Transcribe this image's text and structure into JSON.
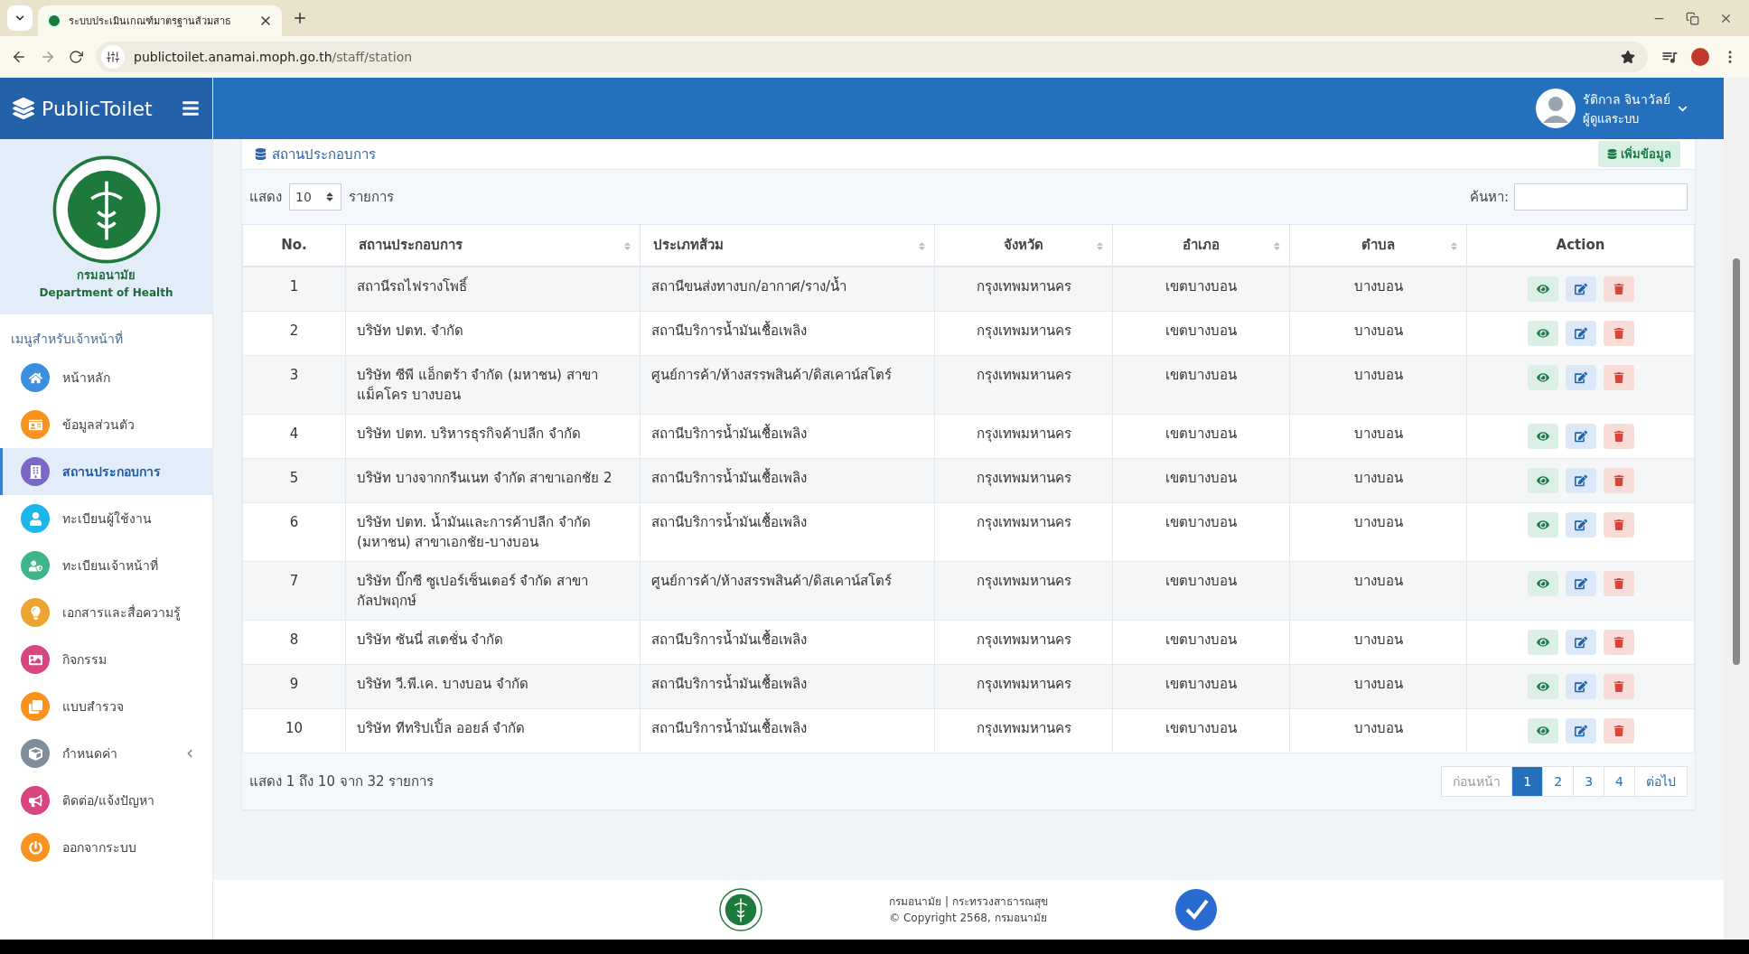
{
  "browser": {
    "tab_title": "ระบบประเมินเกณฑ์มาตรฐานส้วมสาธ",
    "url_host": "publictoilet.anamai.moph.go.th",
    "url_path": "/staff/station"
  },
  "header": {
    "brand": "PublicToilet",
    "user_name": "รัติกาล จินาวัลย์",
    "user_role": "ผู้ดูแลระบบ"
  },
  "sidebar": {
    "org_th": "กรมอนามัย",
    "org_en": "Department of Health",
    "menu_heading": "เมนูสำหรับเจ้าหน้าที่",
    "items": [
      {
        "label": "หน้าหลัก",
        "kind": "home",
        "color": "#3b8ee0",
        "selected": false,
        "submenu": false
      },
      {
        "label": "ข้อมูลส่วนตัว",
        "kind": "card",
        "color": "#f7931e",
        "selected": false,
        "submenu": false
      },
      {
        "label": "สถานประกอบการ",
        "kind": "building",
        "color": "#7b68c4",
        "selected": true,
        "submenu": false
      },
      {
        "label": "ทะเบียนผู้ใช้งาน",
        "kind": "user",
        "color": "#1cb6e8",
        "selected": false,
        "submenu": false
      },
      {
        "label": "ทะเบียนเจ้าหน้าที่",
        "kind": "staff",
        "color": "#3fb58a",
        "selected": false,
        "submenu": false
      },
      {
        "label": "เอกสารและสื่อความรู้",
        "kind": "bulb",
        "color": "#eda531",
        "selected": false,
        "submenu": false
      },
      {
        "label": "กิจกรรม",
        "kind": "image",
        "color": "#d9457f",
        "selected": false,
        "submenu": false
      },
      {
        "label": "แบบสำรวจ",
        "kind": "clone",
        "color": "#f7931e",
        "selected": false,
        "submenu": false
      },
      {
        "label": "กำหนดค่า",
        "kind": "cube",
        "color": "#7f8c99",
        "selected": false,
        "submenu": true
      },
      {
        "label": "ติดต่อ/แจ้งปัญหา",
        "kind": "megaphone",
        "color": "#d9457f",
        "selected": false,
        "submenu": false
      },
      {
        "label": "ออกจากระบบ",
        "kind": "power",
        "color": "#f7931e",
        "selected": false,
        "submenu": false
      }
    ]
  },
  "panel": {
    "title": "สถานประกอบการ",
    "add_button": "เพิ่มข้อมูล",
    "length_prefix": "แสดง",
    "length_value": "10",
    "length_suffix": "รายการ",
    "search_label": "ค้นหา:",
    "columns": [
      {
        "label": "No.",
        "sortable": false
      },
      {
        "label": "สถานประกอบการ",
        "sortable": true
      },
      {
        "label": "ประเภทส้วม",
        "sortable": true
      },
      {
        "label": "จังหวัด",
        "sortable": true
      },
      {
        "label": "อำเภอ",
        "sortable": true
      },
      {
        "label": "ตำบล",
        "sortable": true
      },
      {
        "label": "Action",
        "sortable": false
      }
    ],
    "rows": [
      {
        "no": "1",
        "name": "สถานีรถไฟรางโพธิ์",
        "type": "สถานีขนส่งทางบก/อากาศ/ราง/น้ำ",
        "province": "กรุงเทพมหานคร",
        "district": "เขตบางบอน",
        "subdistrict": "บางบอน"
      },
      {
        "no": "2",
        "name": "บริษัท ปตท. จำกัด",
        "type": "สถานีบริการน้ำมันเชื้อเพลิง",
        "province": "กรุงเทพมหานคร",
        "district": "เขตบางบอน",
        "subdistrict": "บางบอน"
      },
      {
        "no": "3",
        "name": "บริษัท ซีพี แอ็กตร้า จำกัด (มหาชน) สาขาแม็คโคร บางบอน",
        "type": "ศูนย์การค้า/ห้างสรรพสินค้า/ดิสเคาน์สโตร์",
        "province": "กรุงเทพมหานคร",
        "district": "เขตบางบอน",
        "subdistrict": "บางบอน"
      },
      {
        "no": "4",
        "name": "บริษัท ปตท. บริหารธุรกิจค้าปลีก จำกัด",
        "type": "สถานีบริการน้ำมันเชื้อเพลิง",
        "province": "กรุงเทพมหานคร",
        "district": "เขตบางบอน",
        "subdistrict": "บางบอน"
      },
      {
        "no": "5",
        "name": "บริษัท บางจากกรีนเนท จำกัด สาขาเอกชัย 2",
        "type": "สถานีบริการน้ำมันเชื้อเพลิง",
        "province": "กรุงเทพมหานคร",
        "district": "เขตบางบอน",
        "subdistrict": "บางบอน"
      },
      {
        "no": "6",
        "name": "บริษัท ปตท. น้ำมันและการค้าปลีก จำกัด (มหาชน) สาขาเอกชัย-บางบอน",
        "type": "สถานีบริการน้ำมันเชื้อเพลิง",
        "province": "กรุงเทพมหานคร",
        "district": "เขตบางบอน",
        "subdistrict": "บางบอน"
      },
      {
        "no": "7",
        "name": "บริษัท บิ๊กซี ซูเปอร์เซ็นเตอร์ จำกัด สาขา กัลปพฤกษ์",
        "type": "ศูนย์การค้า/ห้างสรรพสินค้า/ดิสเคาน์สโตร์",
        "province": "กรุงเทพมหานคร",
        "district": "เขตบางบอน",
        "subdistrict": "บางบอน"
      },
      {
        "no": "8",
        "name": "บริษัท ซันนี่ สเตชั่น จำกัด",
        "type": "สถานีบริการน้ำมันเชื้อเพลิง",
        "province": "กรุงเทพมหานคร",
        "district": "เขตบางบอน",
        "subdistrict": "บางบอน"
      },
      {
        "no": "9",
        "name": "บริษัท วี.พี.เค. บางบอน จำกัด",
        "type": "สถานีบริการน้ำมันเชื้อเพลิง",
        "province": "กรุงเทพมหานคร",
        "district": "เขตบางบอน",
        "subdistrict": "บางบอน"
      },
      {
        "no": "10",
        "name": "บริษัท ทีทริปเปิ้ล ออยล์ จำกัด",
        "type": "สถานีบริการน้ำมันเชื้อเพลิง",
        "province": "กรุงเทพมหานคร",
        "district": "เขตบางบอน",
        "subdistrict": "บางบอน"
      }
    ],
    "info": "แสดง 1 ถึง 10 จาก 32 รายการ",
    "pagination": [
      {
        "label": "ก่อนหน้า",
        "selected": false,
        "disabled": true
      },
      {
        "label": "1",
        "selected": true,
        "disabled": false
      },
      {
        "label": "2",
        "selected": false,
        "disabled": false
      },
      {
        "label": "3",
        "selected": false,
        "disabled": false
      },
      {
        "label": "4",
        "selected": false,
        "disabled": false
      },
      {
        "label": "ต่อไป",
        "selected": false,
        "disabled": false
      }
    ]
  },
  "footer": {
    "line1": "กรมอนามัย | กระทรวงสาธารณสุข",
    "line2": "© Copyright 2568, กรมอนามัย"
  }
}
